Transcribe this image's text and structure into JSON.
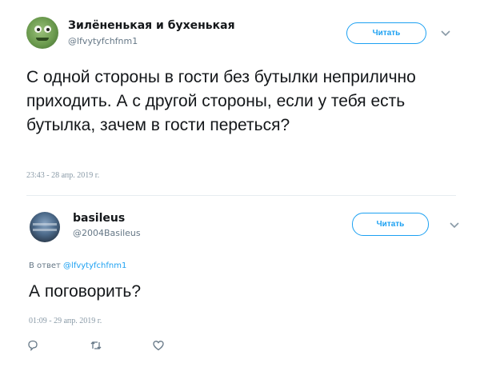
{
  "tweet": {
    "author_name": "Зилёненькая и бухенькая",
    "author_handle": "@lfvytyfchfnm1",
    "follow_label": "Читать",
    "text": "С одной стороны в гости без бутылки неприлично приходить. А с другой стороны, если у тебя есть бутылка, зачем в гости переться?",
    "timestamp": "23:43 - 28 апр. 2019 г."
  },
  "reply": {
    "author_name": "basileus",
    "author_handle": "@2004Basileus",
    "follow_label": "Читать",
    "reply_prefix": "В ответ",
    "reply_to_handle": "@lfvytyfchfnm1",
    "text": "А поговорить?",
    "timestamp": "01:09 - 29 апр. 2019 г."
  },
  "icons": [
    "more-chevron-icon",
    "reply-icon",
    "retweet-icon",
    "like-icon"
  ],
  "colors": {
    "accent": "#1da1f2",
    "secondary_text": "#657786",
    "text": "#14171a"
  }
}
